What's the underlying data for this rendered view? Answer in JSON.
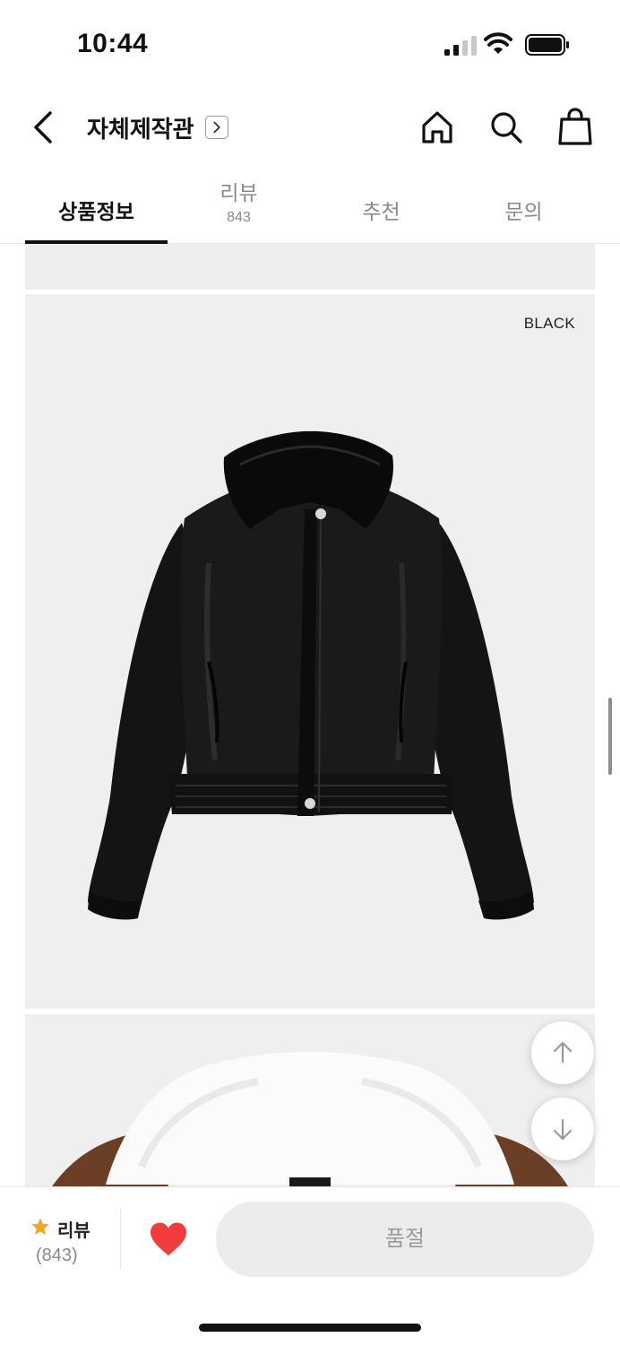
{
  "status_bar": {
    "time": "10:44"
  },
  "header": {
    "title": "자체제작관",
    "icons": [
      "chevron-left-icon",
      "chevron-right-icon",
      "home-icon",
      "search-icon",
      "shopping-bag-icon"
    ]
  },
  "tabs": [
    {
      "label": "상품정보",
      "active": true
    },
    {
      "label": "리뷰",
      "count": "843",
      "active": false
    },
    {
      "label": "추천",
      "active": false
    },
    {
      "label": "문의",
      "active": false
    }
  ],
  "product": {
    "color_label": "BLACK"
  },
  "bottom_bar": {
    "review_label": "리뷰",
    "review_count": "(843)",
    "soldout_label": "품절"
  },
  "colors": {
    "star": "#f5a623",
    "heart": "#f23b3b",
    "active_tab": "#111111",
    "inactive_tab": "#8a8a8a"
  }
}
